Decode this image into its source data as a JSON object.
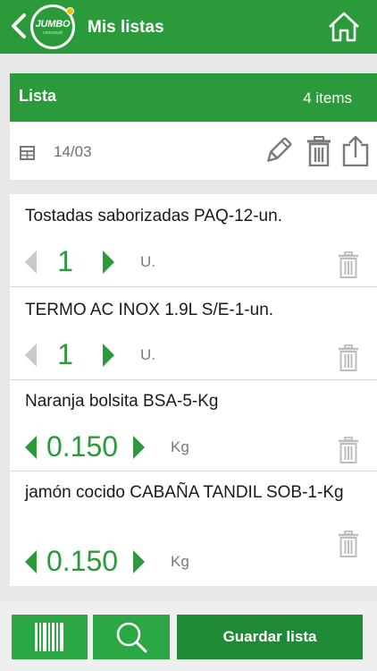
{
  "header": {
    "title": "Mis listas",
    "logo_text": "JUMBO",
    "logo_subtext": "cencosud"
  },
  "list": {
    "label": "Lista",
    "item_count": "4 items",
    "date": "14/03"
  },
  "items": [
    {
      "name": "Tostadas saborizadas PAQ-12-un.",
      "quantity": "1",
      "unit": "U."
    },
    {
      "name": "TERMO AC INOX 1.9L S/E-1-un.",
      "quantity": "1",
      "unit": "U."
    },
    {
      "name": "Naranja bolsita BSA-5-Kg",
      "quantity": "0.150",
      "unit": "Kg"
    },
    {
      "name": "jamón cocido CABAÑA TANDIL SOB-1-Kg",
      "quantity": "0.150",
      "unit": "Kg"
    }
  ],
  "footer": {
    "save_label": "Guardar lista"
  },
  "colors": {
    "brand_green": "#2a9a3a",
    "button_green": "#2ba844",
    "disabled_gray": "#c9c9c9"
  },
  "icons": [
    "back-chevron-icon",
    "home-icon",
    "calendar-icon",
    "edit-pencil-icon",
    "trash-icon",
    "share-export-icon",
    "decrease-arrow-icon",
    "increase-arrow-icon",
    "barcode-icon",
    "search-icon"
  ]
}
